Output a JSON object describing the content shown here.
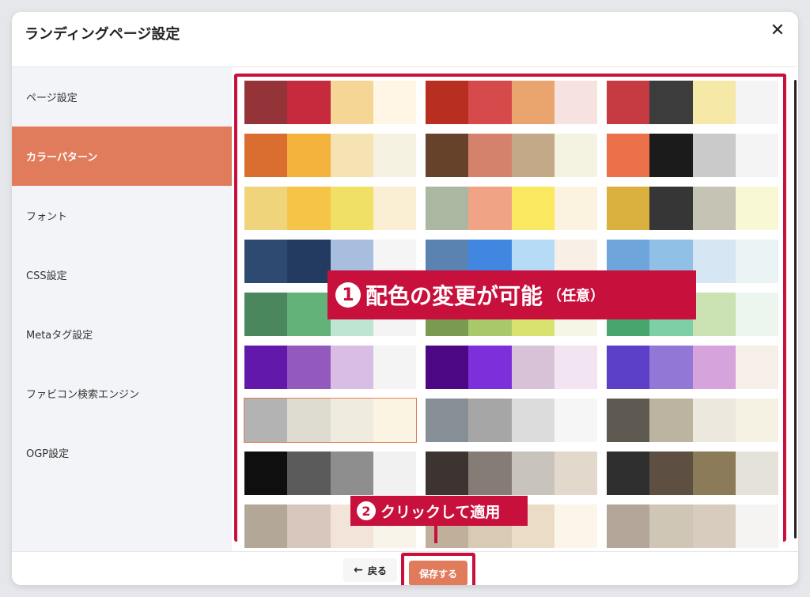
{
  "dialog": {
    "title": "ランディングページ設定"
  },
  "sidebar": {
    "items": [
      {
        "label": "ページ設定"
      },
      {
        "label": "カラーパターン",
        "active": true
      },
      {
        "label": "フォント"
      },
      {
        "label": "CSS設定"
      },
      {
        "label": "Metaタグ設定"
      },
      {
        "label": "ファビコン検索エンジン"
      },
      {
        "label": "OGP設定"
      }
    ]
  },
  "palettes": [
    [
      "#943338",
      "#c52b3c",
      "#f5d694",
      "#fff6e6"
    ],
    [
      "#b82f22",
      "#d64a4c",
      "#e9a56d",
      "#f6e3e0"
    ],
    [
      "#c63a42",
      "#3c3c3c",
      "#f6e8a6",
      "#f4f4f4"
    ],
    [
      "#d96e30",
      "#f3b33d",
      "#f5e3b4",
      "#f6f2e2"
    ],
    [
      "#66422b",
      "#d4826b",
      "#c3a987",
      "#f4f2e0"
    ],
    [
      "#ec7049",
      "#1b1b1b",
      "#cacaca",
      "#f4f4f4"
    ],
    [
      "#f0d47b",
      "#f6c548",
      "#f0e166",
      "#faefd3"
    ],
    [
      "#aab8a2",
      "#f0a485",
      "#fae860",
      "#fbf3e0"
    ],
    [
      "#dab03e",
      "#363636",
      "#c4c3b4",
      "#f8f8d5"
    ],
    [
      "#2f4a70",
      "#233a61",
      "#a8bedf",
      "#f5f5f5"
    ],
    [
      "#5a83b2",
      "#4186e0",
      "#b5dbf6",
      "#f8f0e6"
    ],
    [
      "#6ea5db",
      "#91c0e6",
      "#d6e6f2",
      "#eaf3f4"
    ],
    [
      "#4b875d",
      "#63b27a",
      "#bde5d2",
      "#f4f4f4"
    ],
    [
      "#7a9a50",
      "#a9c86a",
      "#d9e26e",
      "#f6f6e6"
    ],
    [
      "#49a56e",
      "#7fcfa6",
      "#cbe2b3",
      "#edf6ee"
    ],
    [
      "#6219ab",
      "#9459bd",
      "#d9bde4",
      "#f4f4f4"
    ],
    [
      "#4c0884",
      "#7d2fd9",
      "#d7c2d8",
      "#f3e4f2"
    ],
    [
      "#5b3fc7",
      "#9277d7",
      "#d7a3dc",
      "#f6efe8"
    ],
    [
      "#b3b3b3",
      "#dedbd0",
      "#efecdf",
      "#fcf4e3"
    ],
    [
      "#878f96",
      "#a6a6a6",
      "#dcdcdc",
      "#f6f6f6"
    ],
    [
      "#5e5a51",
      "#bcb4a0",
      "#ede8dd",
      "#f5f2e3"
    ],
    [
      "#0f0f0f",
      "#5b5b5b",
      "#8e8e8e",
      "#f1f1f1"
    ],
    [
      "#3d3331",
      "#857c76",
      "#c8c4bc",
      "#e2d9cc"
    ],
    [
      "#2f2f2f",
      "#5d4f41",
      "#8c7b59",
      "#e5e2da"
    ],
    [
      "#b3a898",
      "#d7c7bc",
      "#f3e4da",
      "#f8f4ea"
    ],
    [
      "#c0b09b",
      "#d9cab5",
      "#eadcc7",
      "#fcf6ea"
    ],
    [
      "#b3a699",
      "#d0c6b6",
      "#d8ccbf",
      "#f6f4f2"
    ]
  ],
  "selected_palette": 18,
  "annotations": {
    "step1": {
      "num": "1",
      "text": "配色の変更が可能",
      "sub": "（任意）"
    },
    "step2": {
      "num": "2",
      "text": "クリックして適用"
    }
  },
  "footer": {
    "back_label": "戻る",
    "save_label": "保存する"
  },
  "icons": {
    "close": "close-icon",
    "back": "arrow-left-icon"
  },
  "colors": {
    "accent": "#e07c5c",
    "annotation": "#c8103d"
  }
}
